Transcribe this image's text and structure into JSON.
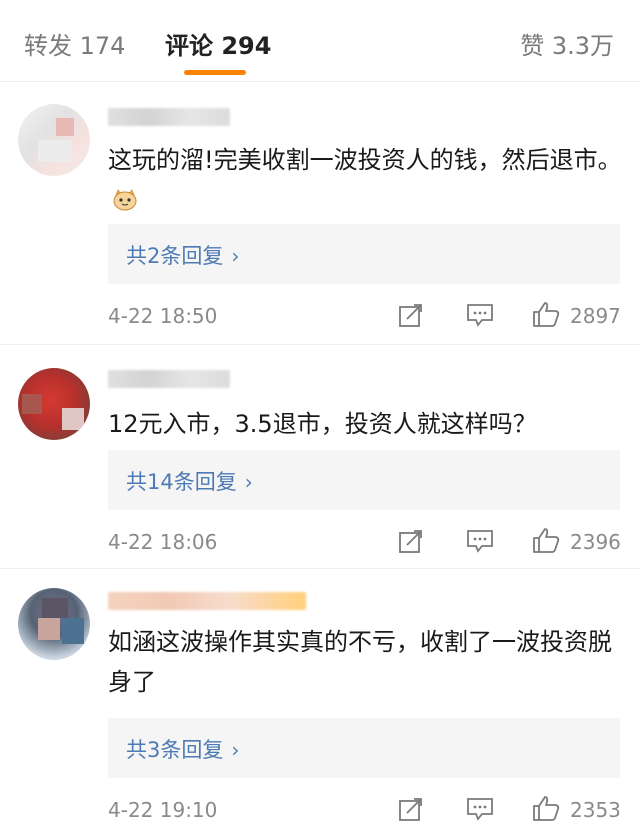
{
  "tabs": {
    "repost": "转发 174",
    "comments": "评论 294",
    "likes": "赞 3.3万"
  },
  "comments": [
    {
      "text": "这玩的溜!完美收割一波投资人的钱，然后退市。",
      "emoji": "cat-face-emoji",
      "replies": "共2条回复",
      "time": "4-22 18:50",
      "likes": "2897"
    },
    {
      "text": "12元入市，3.5退市，投资人就这样吗？",
      "replies": "共14条回复",
      "time": "4-22 18:06",
      "likes": "2396"
    },
    {
      "text": "如涵这波操作其实真的不亏，收割了一波投资脱身了",
      "replies": "共3条回复",
      "time": "4-22 19:10",
      "likes": "2353"
    }
  ],
  "icons": {
    "repost": "repost-icon",
    "comment": "comment-icon",
    "like": "thumbs-up-icon",
    "reply_chevron": "chevron-right-icon"
  },
  "colors": {
    "accent": "#ff8200",
    "reply_link": "#4d7ab3",
    "meta": "#8a8a8a"
  }
}
